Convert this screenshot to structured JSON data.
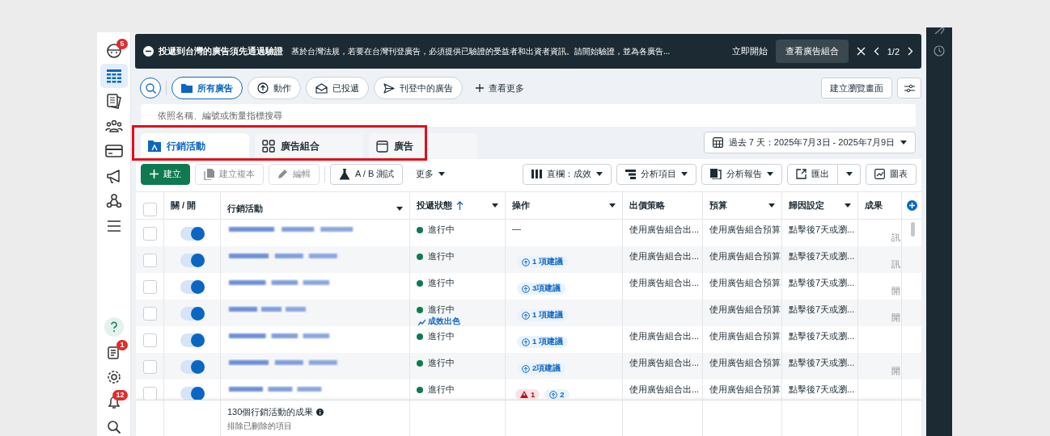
{
  "sidebar": {
    "items": [
      {
        "badge": "5",
        "selected": false
      },
      {
        "selected": true
      },
      {
        "selected": false
      },
      {
        "selected": false
      },
      {
        "selected": false
      },
      {
        "selected": false
      },
      {
        "selected": false
      },
      {
        "selected": false
      }
    ],
    "bottom_items": [
      {
        "selected": false
      },
      {
        "badge": "1",
        "selected": false
      },
      {
        "selected": false
      },
      {
        "badge": "12",
        "selected": false
      },
      {
        "selected": false
      }
    ]
  },
  "banner": {
    "title": "投遞到台灣的廣告須先通過驗證",
    "text": "基於台灣法規，若要在台灣刊登廣告，必須提供已驗證的受益者和出資者資訊。請開始驗證，並為各廣告...",
    "link": "立即開始",
    "button": "查看廣告組合",
    "pager": "1/2"
  },
  "filters": [
    {
      "label": "所有廣告",
      "selected": true
    },
    {
      "label": "動作",
      "selected": false
    },
    {
      "label": "已投遞",
      "selected": false
    },
    {
      "label": "刊登中的廣告",
      "selected": false
    }
  ],
  "more_filters": "查看更多",
  "create_view": "建立瀏覽畫面",
  "search": {
    "placeholder": "依照名稱、編號或衡量指標搜尋"
  },
  "tabs": [
    {
      "label": "行銷活動",
      "selected": true
    },
    {
      "label": "廣告組合",
      "selected": false
    },
    {
      "label": "廣告",
      "selected": false
    }
  ],
  "tabs_highlighted": true,
  "date_range": "過去 7 天：2025年7月3日 - 2025年7月9日",
  "toolbar": {
    "left": [
      {
        "label": "建立",
        "kind": "primary"
      },
      {
        "label": "建立複本",
        "kind": "disabled"
      },
      {
        "label": "編輯",
        "kind": "disabled"
      },
      {
        "label": "A / B 測試",
        "kind": "normal"
      },
      {
        "label": "更多",
        "kind": "menu"
      }
    ],
    "right": [
      {
        "label": "直欄：成效",
        "kind": "dropdown"
      },
      {
        "label": "分析項目",
        "kind": "dropdown"
      },
      {
        "label": "分析報告",
        "kind": "dropdown"
      },
      {
        "label": "匯出",
        "kind": "split"
      },
      {
        "label": "圖表",
        "kind": "normal"
      }
    ]
  },
  "table": {
    "header_checked": false,
    "columns": [
      {
        "label": "關 / 開",
        "menu": false,
        "sorted": false
      },
      {
        "label": "行銷活動",
        "menu": true,
        "sorted": false
      },
      {
        "label": "投遞狀態",
        "menu": true,
        "sorted": true
      },
      {
        "label": "操作",
        "menu": true,
        "sorted": false
      },
      {
        "label": "出價策略",
        "menu": false,
        "sorted": false
      },
      {
        "label": "預算",
        "menu": true,
        "sorted": false
      },
      {
        "label": "歸因設定",
        "menu": true,
        "sorted": false
      },
      {
        "label": "成果",
        "menu": false,
        "sorted": false
      }
    ],
    "rows": [
      {
        "checked": false,
        "on": true,
        "status": "進行中",
        "actions": [
          {
            "kind": "dash",
            "text": "—"
          }
        ],
        "bid": "使用廣告組合出...",
        "budget": "使用廣告組合預算",
        "attribution": "點擊後7天或瀏...",
        "result": "訊"
      },
      {
        "checked": false,
        "on": true,
        "status": "進行中",
        "actions": [
          {
            "kind": "suggestion",
            "text": "1 項建議"
          }
        ],
        "bid": "使用廣告組合出...",
        "budget": "使用廣告組合預算",
        "attribution": "點擊後7天或瀏...",
        "result": "訊"
      },
      {
        "checked": false,
        "on": true,
        "status": "進行中",
        "actions": [
          {
            "kind": "suggestion",
            "text": "3項建議"
          }
        ],
        "bid": "使用廣告組合出...",
        "budget": "使用廣告組合預算",
        "attribution": "點擊後7天或瀏...",
        "result": "開"
      },
      {
        "checked": false,
        "on": true,
        "status": "進行中",
        "status_note": "成效出色",
        "actions": [
          {
            "kind": "suggestion",
            "text": "1 項建議"
          }
        ],
        "budget": "使用廣告組合預算",
        "attribution": "點擊後7天或瀏...",
        "result": "開"
      },
      {
        "checked": false,
        "on": true,
        "status": "進行中",
        "actions": [
          {
            "kind": "suggestion",
            "text": "1 項建議"
          }
        ],
        "bid": "使用廣告組合出...",
        "budget": "使用廣告組合預算",
        "attribution": "點擊後7天或瀏..."
      },
      {
        "checked": false,
        "on": true,
        "status": "進行中",
        "actions": [
          {
            "kind": "suggestion",
            "text": "2項建議"
          }
        ],
        "bid": "使用廣告組合出...",
        "budget": "使用廣告組合預算",
        "attribution": "點擊後7天或瀏...",
        "result": "開"
      },
      {
        "checked": false,
        "on": true,
        "status": "進行中",
        "actions": [
          {
            "kind": "error",
            "text": "1"
          },
          {
            "kind": "suggestion",
            "text": "2"
          }
        ],
        "bid": "使用廣告組合出...",
        "budget": "使用廣告組合預算",
        "attribution": "點擊後7天或瀏..."
      }
    ],
    "footer": {
      "title": "130個行銷活動的成果",
      "note": "排除已刪除的項目"
    }
  }
}
